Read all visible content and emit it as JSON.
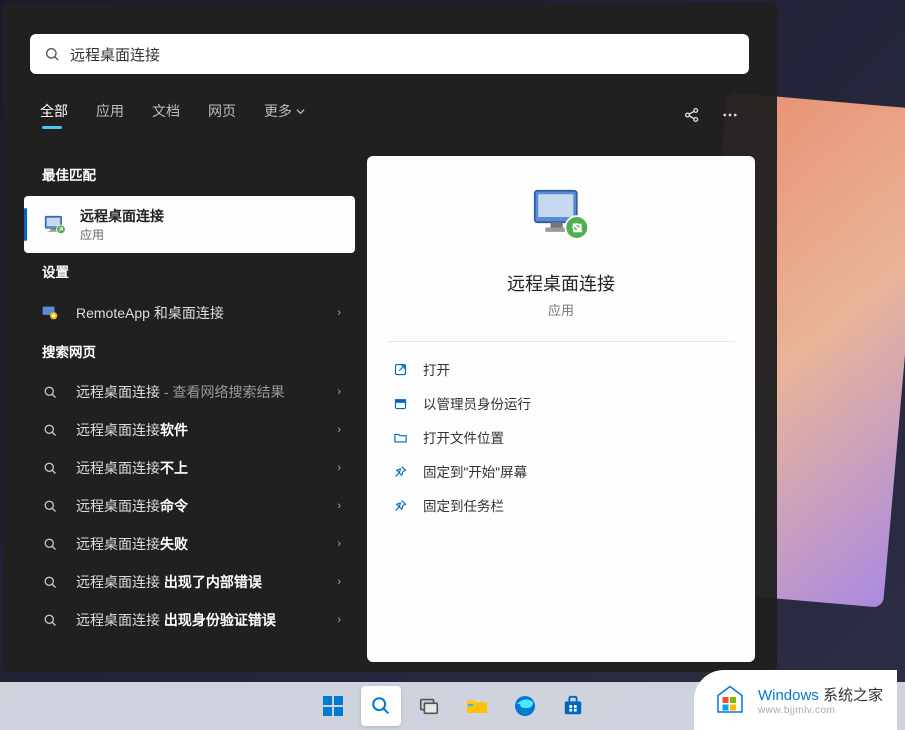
{
  "search": {
    "query": "远程桌面连接"
  },
  "tabs": {
    "all": "全部",
    "apps": "应用",
    "docs": "文档",
    "web": "网页",
    "more": "更多"
  },
  "sections": {
    "best_match": "最佳匹配",
    "settings": "设置",
    "web_search": "搜索网页"
  },
  "best_match": {
    "title": "远程桌面连接",
    "subtitle": "应用"
  },
  "settings_items": [
    {
      "label": "RemoteApp 和桌面连接"
    }
  ],
  "web_items": [
    {
      "prefix": "远程桌面连接",
      "suffix": " - 查看网络搜索结果",
      "suffix_light": true
    },
    {
      "prefix": "远程桌面连接",
      "bold": "软件"
    },
    {
      "prefix": "远程桌面连接",
      "bold": "不上"
    },
    {
      "prefix": "远程桌面连接",
      "bold": "命令"
    },
    {
      "prefix": "远程桌面连接",
      "bold": "失败"
    },
    {
      "prefix": "远程桌面连接 ",
      "bold": "出现了内部错误"
    },
    {
      "prefix": "远程桌面连接 ",
      "bold": "出现身份验证错误"
    }
  ],
  "preview": {
    "title": "远程桌面连接",
    "subtitle": "应用",
    "actions": [
      {
        "icon": "open",
        "label": "打开"
      },
      {
        "icon": "admin",
        "label": "以管理员身份运行"
      },
      {
        "icon": "folder",
        "label": "打开文件位置"
      },
      {
        "icon": "pin",
        "label": "固定到\"开始\"屏幕"
      },
      {
        "icon": "pin",
        "label": "固定到任务栏"
      }
    ]
  },
  "watermark": {
    "brand_en": "Windows",
    "brand_cn": "系统之家",
    "url": "www.bjjmlv.com"
  }
}
